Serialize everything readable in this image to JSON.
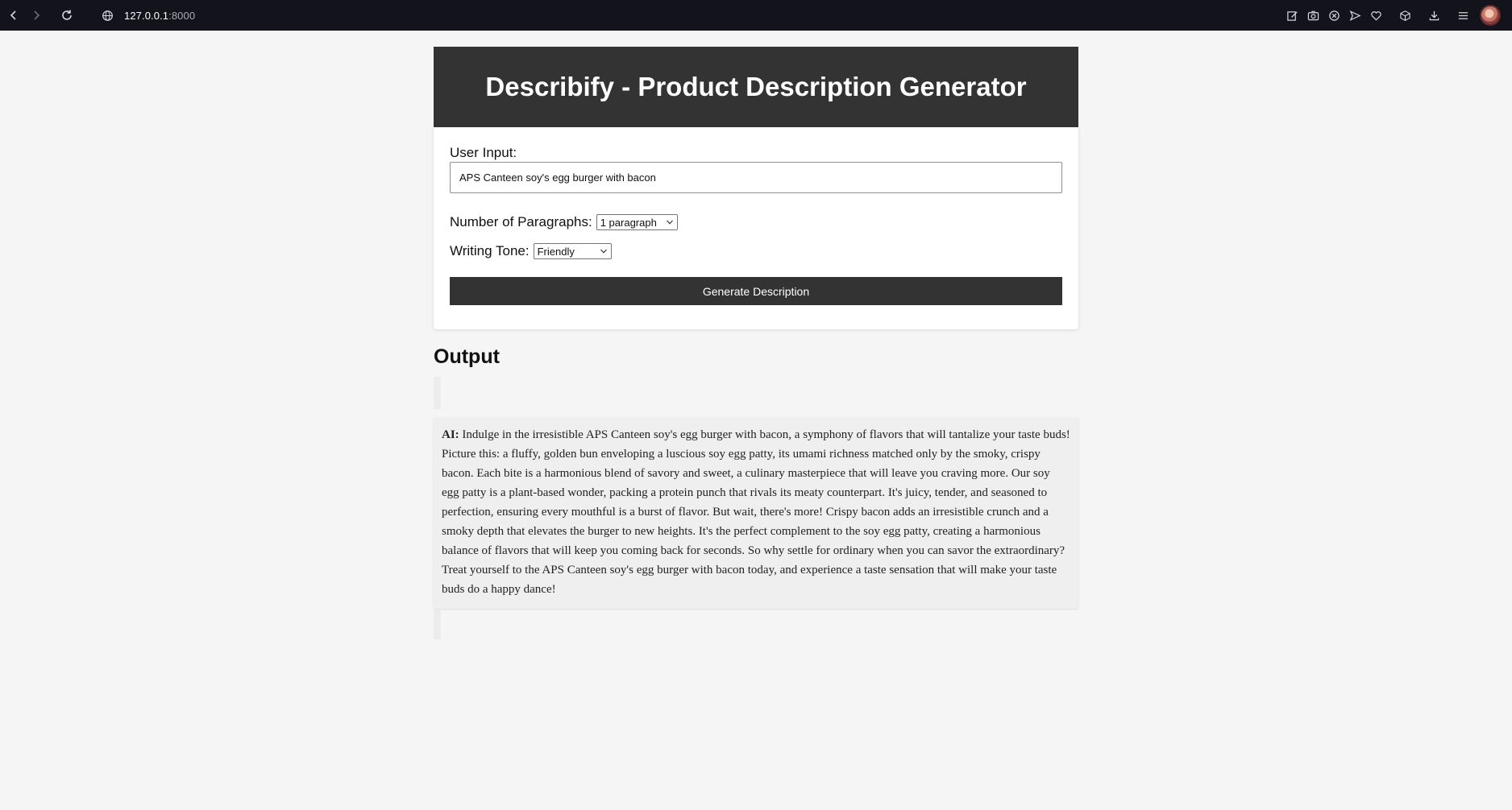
{
  "browser": {
    "url_host": "127.0.0.1",
    "url_port": ":8000"
  },
  "app": {
    "title": "Describify - Product Description Generator"
  },
  "form": {
    "user_input_label": "User Input:",
    "user_input_value": "APS Canteen soy's egg burger with bacon",
    "paragraphs_label": "Number of Paragraphs:",
    "paragraphs_selected": "1 paragraph",
    "tone_label": "Writing Tone:",
    "tone_selected": "Friendly",
    "generate_label": "Generate Description"
  },
  "output": {
    "heading": "Output",
    "messages": [
      {
        "speaker": "AI:",
        "text": "Indulge in the irresistible APS Canteen soy's egg burger with bacon, a symphony of flavors that will tantalize your taste buds! Picture this: a fluffy, golden bun enveloping a luscious soy egg patty, its umami richness matched only by the smoky, crispy bacon. Each bite is a harmonious blend of savory and sweet, a culinary masterpiece that will leave you craving more. Our soy egg patty is a plant-based wonder, packing a protein punch that rivals its meaty counterpart. It's juicy, tender, and seasoned to perfection, ensuring every mouthful is a burst of flavor. But wait, there's more! Crispy bacon adds an irresistible crunch and a smoky depth that elevates the burger to new heights. It's the perfect complement to the soy egg patty, creating a harmonious balance of flavors that will keep you coming back for seconds. So why settle for ordinary when you can savor the extraordinary? Treat yourself to the APS Canteen soy's egg burger with bacon today, and experience a taste sensation that will make your taste buds do a happy dance!"
      }
    ]
  }
}
